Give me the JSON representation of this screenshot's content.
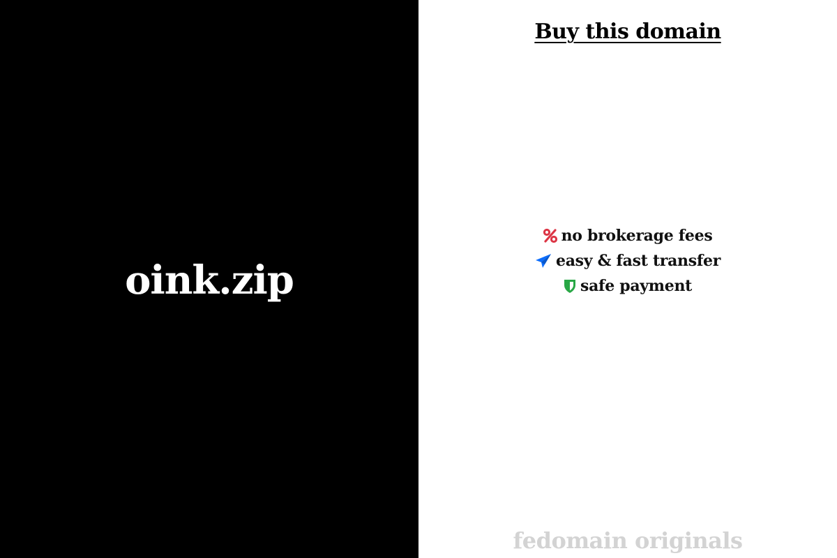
{
  "domain": {
    "name": "oink.zip"
  },
  "buy": {
    "label": "Buy this domain"
  },
  "features": [
    {
      "icon": "percent-icon",
      "icon_color": "#dc3545",
      "label": "no brokerage fees"
    },
    {
      "icon": "paper-plane-icon",
      "icon_color": "#0d6efd",
      "label": "easy & fast transfer"
    },
    {
      "icon": "shield-icon",
      "icon_color": "#28a745",
      "label": "safe payment"
    }
  ],
  "footer": {
    "brand": "fedomain originals"
  },
  "colors": {
    "left_background": "#000000",
    "right_background": "#ffffff",
    "footer_text": "#d3d3d3"
  }
}
